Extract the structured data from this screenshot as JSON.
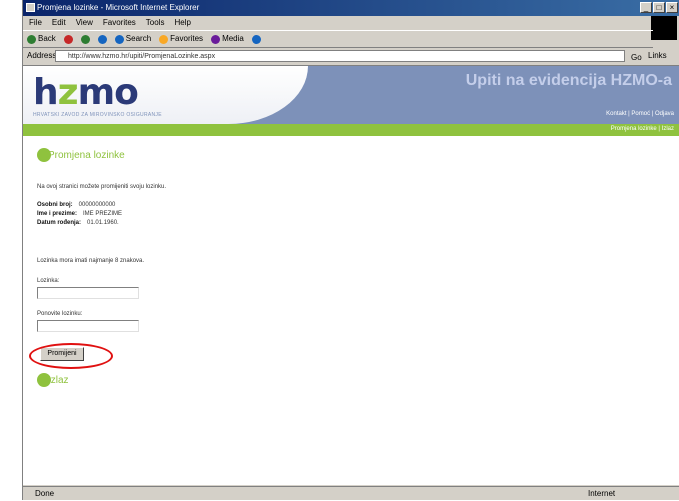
{
  "window": {
    "title": "Promjena lozinke - Microsoft Internet Explorer",
    "controls": [
      "_",
      "□",
      "×"
    ]
  },
  "menubar": {
    "items": [
      "File",
      "Edit",
      "View",
      "Favorites",
      "Tools",
      "Help"
    ]
  },
  "toolbar": {
    "items": [
      {
        "label": "Back",
        "icon": "back-icon",
        "color": "#2e7d32"
      },
      {
        "label": "Stop",
        "icon": "stop-icon",
        "color": "#c62828"
      },
      {
        "label": "Refresh",
        "icon": "refresh-icon",
        "color": "#2e7d32"
      },
      {
        "label": "Home",
        "icon": "home-icon",
        "color": "#1565c0"
      },
      {
        "label": "Search",
        "icon": "search-icon",
        "color": "#1565c0"
      },
      {
        "label": "Favorites",
        "icon": "favorites-icon",
        "color": "#f9a825"
      },
      {
        "label": "Media",
        "icon": "media-icon",
        "color": "#6a1b9a"
      },
      {
        "label": "History",
        "icon": "history-icon",
        "color": "#1565c0"
      }
    ]
  },
  "addressbar": {
    "label": "Address",
    "url": "http://www.hzmo.hr/upiti/PromjenaLozinke.aspx",
    "go_label": "Go",
    "links_label": "Links"
  },
  "banner": {
    "logo_h": "h",
    "logo_z": "z",
    "logo_rest": "mo",
    "logo_sub": "HRVATSKI ZAVOD ZA MIROVINSKO OSIGURANJE",
    "title": "Upiti na evidencija HZMO-a",
    "nav": "Kontakt | Pomoć | Odjava",
    "green_text": "Promjena lozinke | Izlaz"
  },
  "main": {
    "heading": "Promjena lozinke",
    "intro": "Na ovoj stranici možete promijeniti svoju lozinku.",
    "rows": [
      {
        "label": "Osobni broj:",
        "value": "00000000000"
      },
      {
        "label": "Ime i prezime:",
        "value": "IME PREZIME"
      },
      {
        "label": "Datum rođenja:",
        "value": "01.01.1960."
      }
    ],
    "instruction": "Lozinka mora imati najmanje 8 znakova.",
    "field1_label": "Lozinka:",
    "field2_label": "Ponovite lozinku:",
    "submit_label": "Promijeni",
    "exit_heading": "Izlaz"
  },
  "status": {
    "left": "Done",
    "right": "Internet"
  }
}
